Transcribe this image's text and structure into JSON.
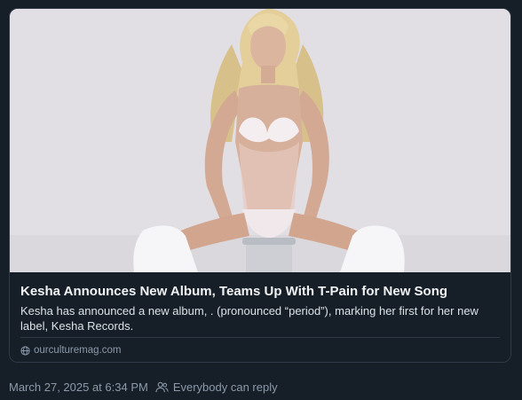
{
  "link_card": {
    "image_alt": "Kesha posing in a white lace outfit with a clear corset and white crystal-studded boots, seated on a clear stool",
    "title": "Kesha Announces New Album, Teams Up With T-Pain for New Song",
    "description": "Kesha has announced a new album, . (pronounced “period”), marking her first for her new label, Kesha Records.",
    "domain": "ourculturemag.com",
    "domain_icon": "globe-icon"
  },
  "post_meta": {
    "timestamp": "March 27, 2025 at 6:34 PM",
    "reply_setting": "Everybody can reply",
    "reply_icon": "people-icon"
  },
  "colors": {
    "background": "#161e27",
    "card_border": "#2e3a48",
    "title": "#f1f3f5",
    "description": "#dbe1e7",
    "muted": "#8c9aab",
    "image_background": "#e1dfe3"
  }
}
